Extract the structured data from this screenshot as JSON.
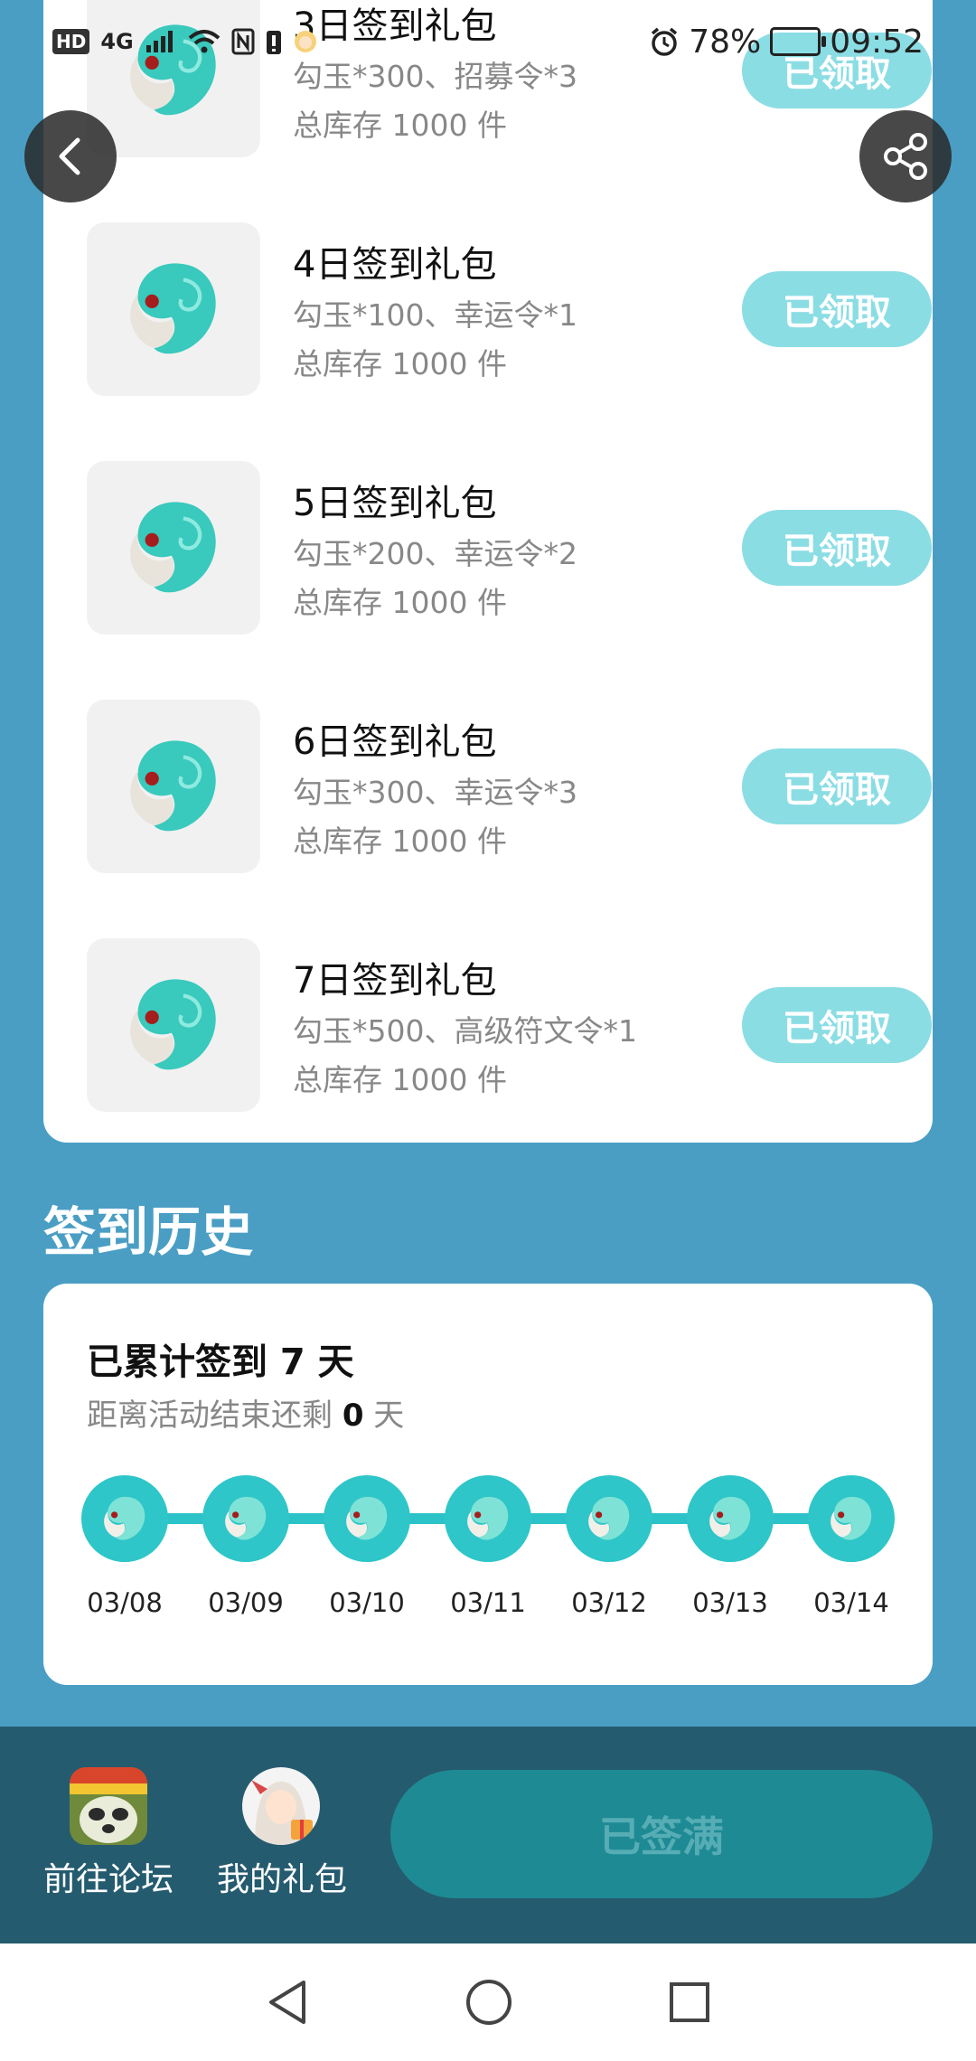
{
  "status": {
    "hd": "HD",
    "network": "4G",
    "battery": "78%",
    "time": "09:52"
  },
  "gifts": [
    {
      "title": "3日签到礼包",
      "desc": "勾玉*300、招募令*3",
      "stock": "总库存 1000 件",
      "button": "已领取"
    },
    {
      "title": "4日签到礼包",
      "desc": "勾玉*100、幸运令*1",
      "stock": "总库存 1000 件",
      "button": "已领取"
    },
    {
      "title": "5日签到礼包",
      "desc": "勾玉*200、幸运令*2",
      "stock": "总库存 1000 件",
      "button": "已领取"
    },
    {
      "title": "6日签到礼包",
      "desc": "勾玉*300、幸运令*3",
      "stock": "总库存 1000 件",
      "button": "已领取"
    },
    {
      "title": "7日签到礼包",
      "desc": "勾玉*500、高级符文令*1",
      "stock": "总库存 1000 件",
      "button": "已领取"
    }
  ],
  "history": {
    "section_title": "签到历史",
    "total": "已累计签到 7 天",
    "remain_prefix": "距离活动结束还剩",
    "remain_days": "0",
    "remain_suffix": "天",
    "dates": [
      "03/08",
      "03/09",
      "03/10",
      "03/11",
      "03/12",
      "03/13",
      "03/14"
    ]
  },
  "bottom": {
    "forum_label": "前往论坛",
    "gifts_label": "我的礼包",
    "main_button": "已签满"
  },
  "icons": {
    "back": "back-arrow-icon",
    "share": "share-icon",
    "gift": "magatama-icon"
  },
  "colors": {
    "background": "#4a9ec4",
    "accent": "#2ec6c8",
    "button_disabled": "#8bdde4",
    "bottom_bar": "#255b6f"
  }
}
